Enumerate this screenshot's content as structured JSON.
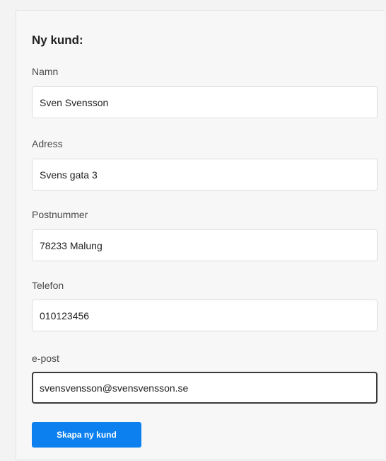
{
  "form": {
    "title": "Ny kund:",
    "fields": [
      {
        "label": "Namn",
        "value": "Sven Svensson"
      },
      {
        "label": "Adress",
        "value": "Svens gata 3"
      },
      {
        "label": "Postnummer",
        "value": "78233 Malung"
      },
      {
        "label": "Telefon",
        "value": "010123456"
      },
      {
        "label": "e-post",
        "value": "svensvensson@svensvensson.se"
      }
    ],
    "submit_label": "Skapa ny kund"
  },
  "colors": {
    "accent": "#0d80f0",
    "background": "#f3f3f3",
    "panel": "#f7f7f7"
  }
}
